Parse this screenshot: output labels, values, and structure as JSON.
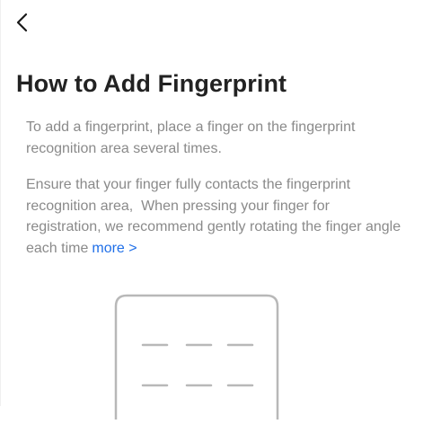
{
  "header": {
    "back_icon": "chevron-left-icon"
  },
  "main": {
    "title": "How to Add Fingerprint",
    "paragraph_1": "To add a fingerprint, place a finger on the fingerprint recognition area several times.",
    "paragraph_2": "Ensure that your finger fully contacts the fingerprint recognition area,  When pressing your finger for registration, we recommend gently rotating the finger angle each time",
    "more_link": "more >",
    "illustration_icon": "phone-keypad-icon"
  },
  "colors": {
    "link": "#1f6fe8",
    "body_text": "#8a8a8a",
    "title_text": "#222222",
    "illustration_stroke": "#b8b8b8"
  }
}
